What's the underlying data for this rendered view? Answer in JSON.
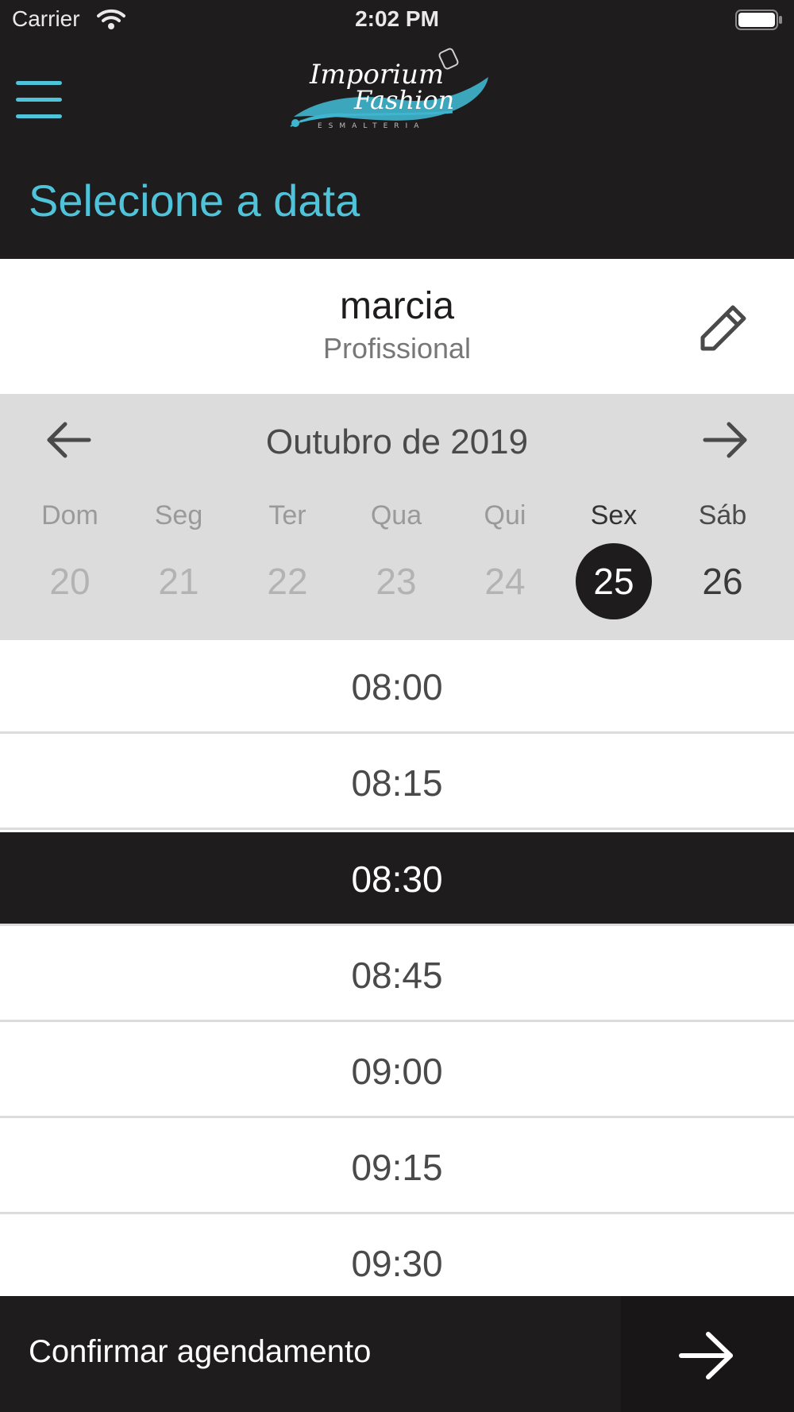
{
  "status_bar": {
    "carrier": "Carrier",
    "time": "2:02 PM"
  },
  "header": {
    "menu_icon": "hamburger-menu-icon",
    "logo": {
      "line1": "Imporium",
      "line2": "Fashion",
      "subtitle": "ESMALTERIA"
    },
    "title": "Selecione a data",
    "accent_color": "#4ec3d9",
    "background_color": "#1e1c1d"
  },
  "professional": {
    "name": "marcia",
    "role": "Profissional",
    "edit_icon": "pencil-icon"
  },
  "calendar": {
    "month_label": "Outubro de 2019",
    "prev_icon": "arrow-left-icon",
    "next_icon": "arrow-right-icon",
    "days": [
      {
        "name": "Dom",
        "number": "20",
        "state": "past"
      },
      {
        "name": "Seg",
        "number": "21",
        "state": "past"
      },
      {
        "name": "Ter",
        "number": "22",
        "state": "past"
      },
      {
        "name": "Qua",
        "number": "23",
        "state": "past"
      },
      {
        "name": "Qui",
        "number": "24",
        "state": "past"
      },
      {
        "name": "Sex",
        "number": "25",
        "state": "selected"
      },
      {
        "name": "Sáb",
        "number": "26",
        "state": "future"
      }
    ]
  },
  "time_slots": [
    {
      "time": "08:00",
      "selected": false
    },
    {
      "time": "08:15",
      "selected": false
    },
    {
      "time": "08:30",
      "selected": true
    },
    {
      "time": "08:45",
      "selected": false
    },
    {
      "time": "09:00",
      "selected": false
    },
    {
      "time": "09:15",
      "selected": false
    },
    {
      "time": "09:30",
      "selected": false
    }
  ],
  "footer": {
    "confirm_label": "Confirmar agendamento",
    "arrow_icon": "arrow-right-icon"
  }
}
